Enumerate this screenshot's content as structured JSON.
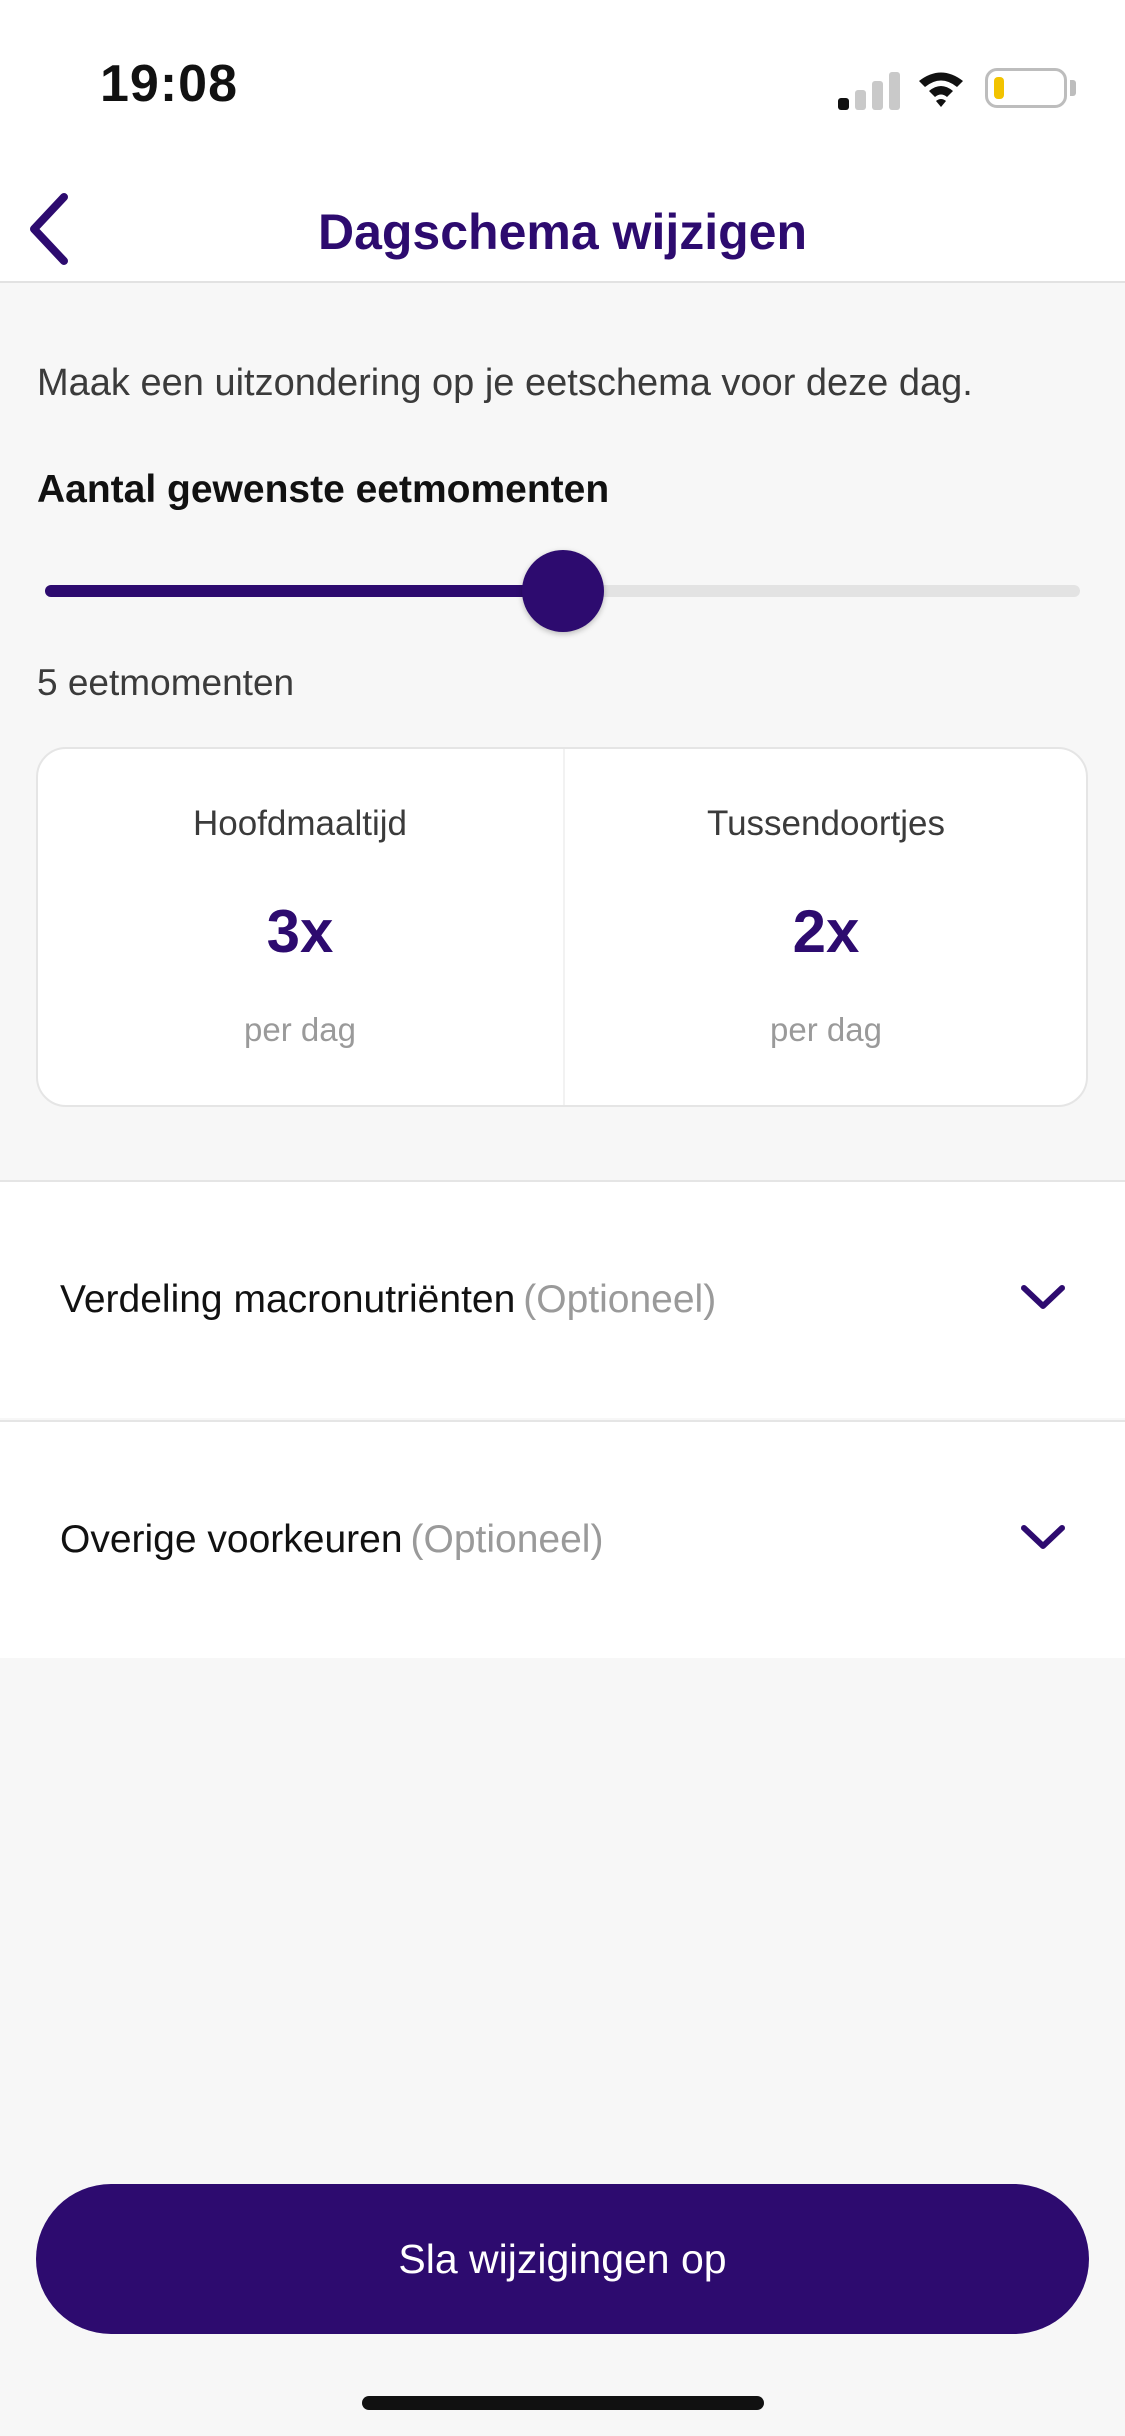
{
  "status_bar": {
    "time": "19:08",
    "signal_bars": 4,
    "signal_active": 1,
    "battery_level": 0.15,
    "battery_color": "#f2c300"
  },
  "header": {
    "title": "Dagschema wijzigen",
    "back_icon": "chevron-left-icon"
  },
  "intro_text": "Maak een uitzondering op je eetschema voor deze dag.",
  "meals": {
    "heading": "Aantal gewenste eetmomenten",
    "slider_fraction": 0.5,
    "value_label": "5 eetmomenten",
    "main": {
      "label": "Hoofdmaaltijd",
      "count": "3x",
      "unit": "per dag"
    },
    "snacks": {
      "label": "Tussendoortjes",
      "count": "2x",
      "unit": "per dag"
    }
  },
  "sections": [
    {
      "title": "Verdeling macronutriënten",
      "optional": "(Optioneel)",
      "icon": "chevron-down-icon"
    },
    {
      "title": "Overige voorkeuren",
      "optional": "(Optioneel)",
      "icon": "chevron-down-icon"
    }
  ],
  "save_label": "Sla wijzigingen op",
  "colors": {
    "accent": "#2d0b6f",
    "muted_text": "#9a9a9a",
    "background": "#f7f7f7"
  }
}
